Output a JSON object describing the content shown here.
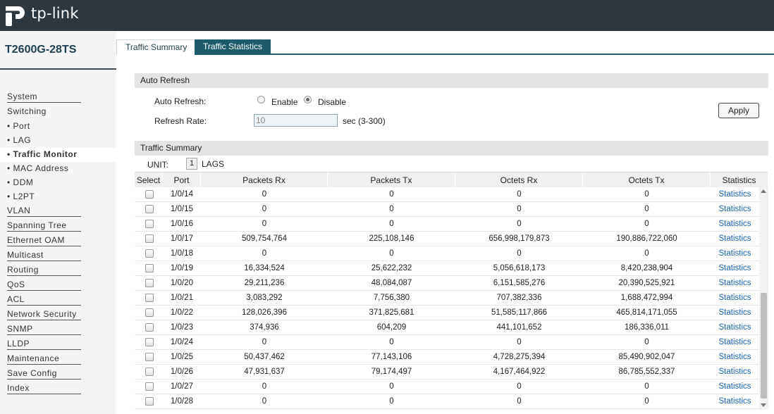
{
  "header": {
    "logo_text": "tp-link"
  },
  "sidebar": {
    "model": "T2600G-28TS",
    "items": [
      {
        "label": "System",
        "type": "top"
      },
      {
        "label": "Switching",
        "type": "top-plain"
      },
      {
        "label": "Port",
        "type": "sub"
      },
      {
        "label": "LAG",
        "type": "sub"
      },
      {
        "label": "Traffic Monitor",
        "type": "sub",
        "active": true
      },
      {
        "label": "MAC Address",
        "type": "sub"
      },
      {
        "label": "DDM",
        "type": "sub"
      },
      {
        "label": "L2PT",
        "type": "sub"
      },
      {
        "label": "VLAN",
        "type": "top"
      },
      {
        "label": "Spanning Tree",
        "type": "top"
      },
      {
        "label": "Ethernet OAM",
        "type": "top"
      },
      {
        "label": "Multicast",
        "type": "top"
      },
      {
        "label": "Routing",
        "type": "top"
      },
      {
        "label": "QoS",
        "type": "top"
      },
      {
        "label": "ACL",
        "type": "top"
      },
      {
        "label": "Network Security",
        "type": "top"
      },
      {
        "label": "SNMP",
        "type": "top"
      },
      {
        "label": "LLDP",
        "type": "top"
      },
      {
        "label": "Maintenance",
        "type": "top"
      },
      {
        "label": "Save Config",
        "type": "top"
      },
      {
        "label": "Index",
        "type": "top"
      }
    ]
  },
  "tabs": {
    "summary": "Traffic Summary",
    "statistics": "Traffic Statistics"
  },
  "auto_refresh": {
    "section_title": "Auto Refresh",
    "auto_refresh_label": "Auto Refresh:",
    "enable_label": "Enable",
    "disable_label": "Disable",
    "selected": "Disable",
    "rate_label": "Refresh Rate:",
    "rate_value": "10",
    "rate_unit": "sec (3-300)",
    "apply_label": "Apply"
  },
  "traffic_summary": {
    "section_title": "Traffic Summary",
    "unit_label": "UNIT:",
    "unit_value": "1",
    "lags_label": "LAGS",
    "columns": [
      "Select",
      "Port",
      "Packets Rx",
      "Packets Tx",
      "Octets Rx",
      "Octets Tx",
      "Statistics"
    ],
    "link_label": "Statistics",
    "rows": [
      {
        "port": "1/0/14",
        "packets_rx": "0",
        "packets_tx": "0",
        "octets_rx": "0",
        "octets_tx": "0"
      },
      {
        "port": "1/0/15",
        "packets_rx": "0",
        "packets_tx": "0",
        "octets_rx": "0",
        "octets_tx": "0"
      },
      {
        "port": "1/0/16",
        "packets_rx": "0",
        "packets_tx": "0",
        "octets_rx": "0",
        "octets_tx": "0"
      },
      {
        "port": "1/0/17",
        "packets_rx": "509,754,764",
        "packets_tx": "225,108,146",
        "octets_rx": "656,998,179,873",
        "octets_tx": "190,886,722,060"
      },
      {
        "port": "1/0/18",
        "packets_rx": "0",
        "packets_tx": "0",
        "octets_rx": "0",
        "octets_tx": "0"
      },
      {
        "port": "1/0/19",
        "packets_rx": "16,334,524",
        "packets_tx": "25,622,232",
        "octets_rx": "5,056,618,173",
        "octets_tx": "8,420,238,904"
      },
      {
        "port": "1/0/20",
        "packets_rx": "29,211,236",
        "packets_tx": "48,084,087",
        "octets_rx": "6,151,585,276",
        "octets_tx": "20,390,525,921"
      },
      {
        "port": "1/0/21",
        "packets_rx": "3,083,292",
        "packets_tx": "7,756,380",
        "octets_rx": "707,382,336",
        "octets_tx": "1,688,472,994"
      },
      {
        "port": "1/0/22",
        "packets_rx": "128,026,396",
        "packets_tx": "371,825,681",
        "octets_rx": "51,585,117,866",
        "octets_tx": "465,814,171,055"
      },
      {
        "port": "1/0/23",
        "packets_rx": "374,936",
        "packets_tx": "604,209",
        "octets_rx": "441,101,652",
        "octets_tx": "186,336,011"
      },
      {
        "port": "1/0/24",
        "packets_rx": "0",
        "packets_tx": "0",
        "octets_rx": "0",
        "octets_tx": "0"
      },
      {
        "port": "1/0/25",
        "packets_rx": "50,437,462",
        "packets_tx": "77,143,106",
        "octets_rx": "4,728,275,394",
        "octets_tx": "85,490,902,047"
      },
      {
        "port": "1/0/26",
        "packets_rx": "47,931,637",
        "packets_tx": "79,174,497",
        "octets_rx": "4,167,464,922",
        "octets_tx": "86,785,552,337"
      },
      {
        "port": "1/0/27",
        "packets_rx": "0",
        "packets_tx": "0",
        "octets_rx": "0",
        "octets_tx": "0"
      },
      {
        "port": "1/0/28",
        "packets_rx": "0",
        "packets_tx": "0",
        "octets_rx": "0",
        "octets_tx": "0"
      }
    ]
  },
  "colors": {
    "header_bg": "#2c373f",
    "accent": "#1d5b6c",
    "link": "#1a63b0"
  }
}
